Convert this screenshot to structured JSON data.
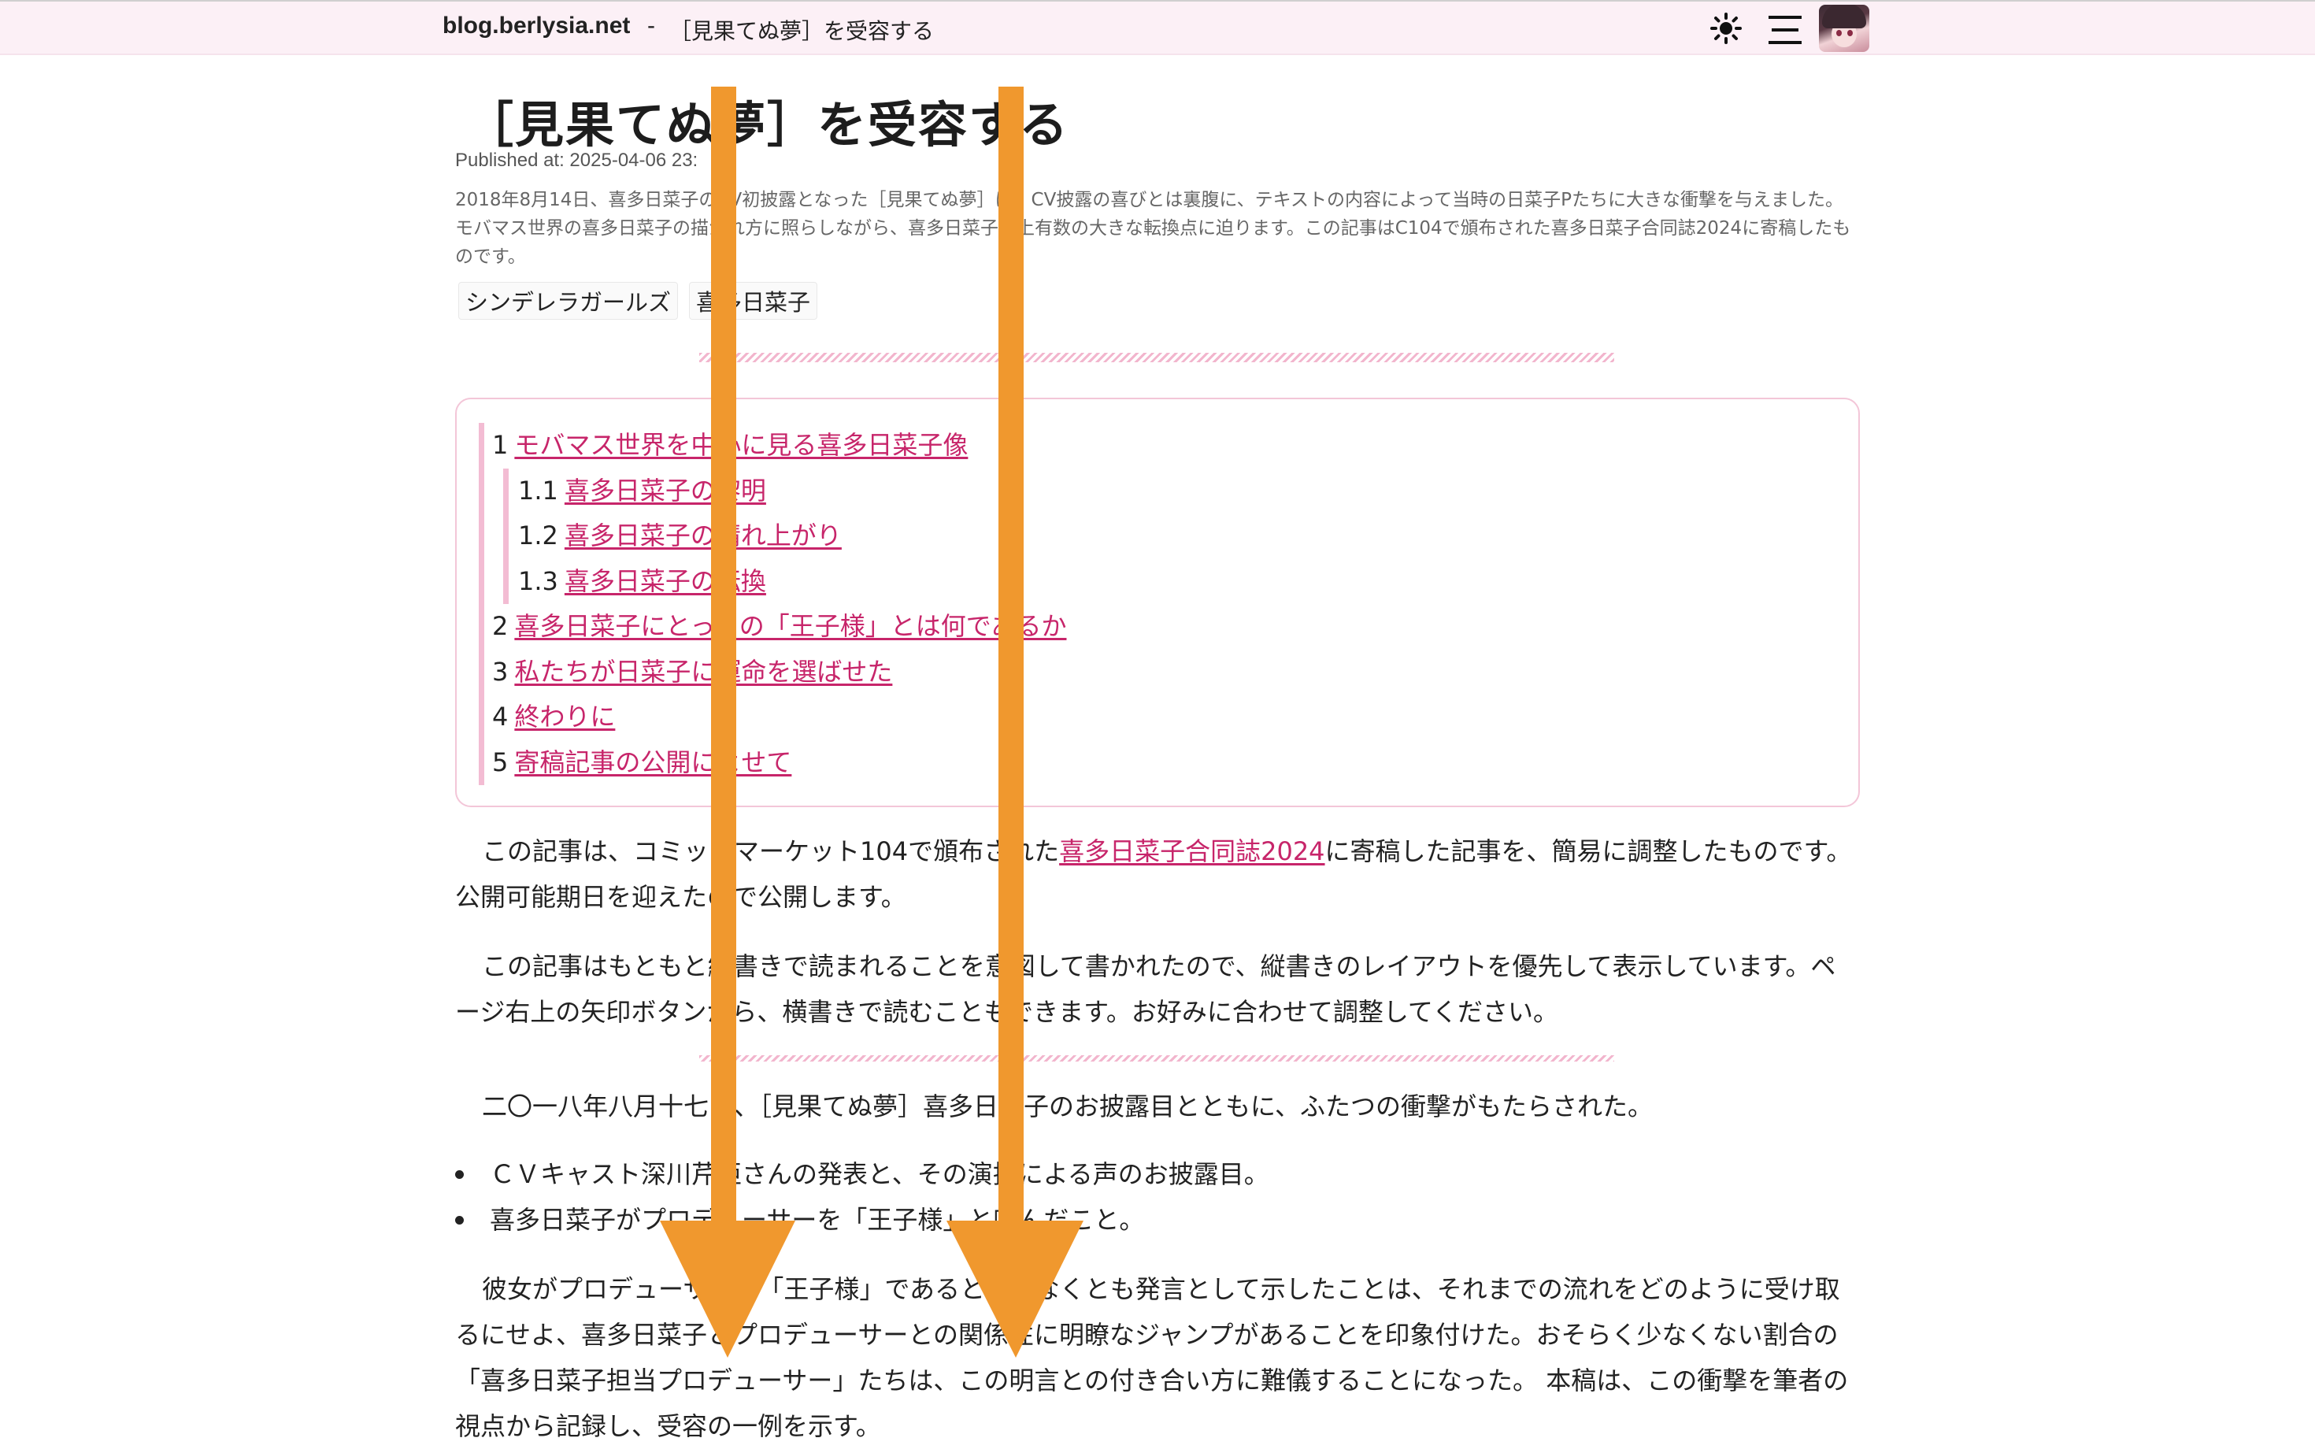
{
  "header": {
    "site_name": "blog.berlysia.net",
    "separator": " -",
    "page_title": "［見果てぬ夢］を受容する",
    "theme_icon": "sun-icon",
    "menu_icon": "hamburger-menu-icon",
    "avatar": "user-avatar"
  },
  "article": {
    "title": "［見果てぬ夢］を受容する",
    "published": "Published at: 2025-04-06 23:",
    "summary": "2018年8月14日、喜多日菜子のCV初披露となった［見果てぬ夢］は、CV披露の喜びとは裏腹に、テキストの内容によって当時の日菜子Pたちに大きな衝撃を与えました。モバマス世界の喜多日菜子の描かれ方に照らしながら、喜多日菜子史上有数の大きな転換点に迫ります。この記事はC104で頒布された喜多日菜子合同誌2024に寄稿したものです。",
    "tags": [
      "シンデレラガールズ",
      "喜多日菜子"
    ]
  },
  "toc": {
    "items": [
      {
        "num": "1",
        "label": "モバマス世界を中心に見る喜多日菜子像"
      },
      {
        "num": "1.1",
        "label": "喜多日菜子の黎明"
      },
      {
        "num": "1.2",
        "label": "喜多日菜子の晴れ上がり"
      },
      {
        "num": "1.3",
        "label": "喜多日菜子の転換"
      },
      {
        "num": "2",
        "label": "喜多日菜子にとっての「王子様」とは何であるか"
      },
      {
        "num": "3",
        "label": "私たちが日菜子に運命を選ばせた"
      },
      {
        "num": "4",
        "label": "終わりに"
      },
      {
        "num": "5",
        "label": "寄稿記事の公開によせて"
      }
    ]
  },
  "body": {
    "p1_before": "この記事は、コミックマーケット104で頒布された",
    "p1_link": "喜多日菜子合同誌2024",
    "p1_after": "に寄稿した記事を、簡易に調整したものです。公開可能期日を迎えたので公開します。",
    "p2": "この記事はもともと縦書きで読まれることを意図して書かれたので、縦書きのレイアウトを優先して表示しています。ページ右上の矢印ボタンから、横書きで読むこともできます。お好みに合わせて調整してください。",
    "p3": "二〇一八年八月十七日、［見果てぬ夢］喜多日菜子のお披露目とともに、ふたつの衝撃がもたらされた。",
    "bullets": [
      "ＣＶキャスト深川芹亜さんの発表と、その演技による声のお披露目。",
      "喜多日菜子がプロデューサーを「王子様」と呼んだこと。"
    ],
    "p4": "彼女がプロデューサーを「王子様」であると、少なくとも発言として示したことは、それまでの流れをどのように受け取るにせよ、喜多日菜子とプロデューサーとの関係性に明瞭なジャンプがあることを印象付けた。おそらく少なくない割合の「喜多日菜子担当プロデューサー」たちは、この明言との付き合い方に難儀することになった。 本稿は、この衝撃を筆者の視点から記録し、受容の一例を示す。"
  },
  "annotation": {
    "arrow_color": "#f0982e",
    "arrow_direction": "down"
  }
}
